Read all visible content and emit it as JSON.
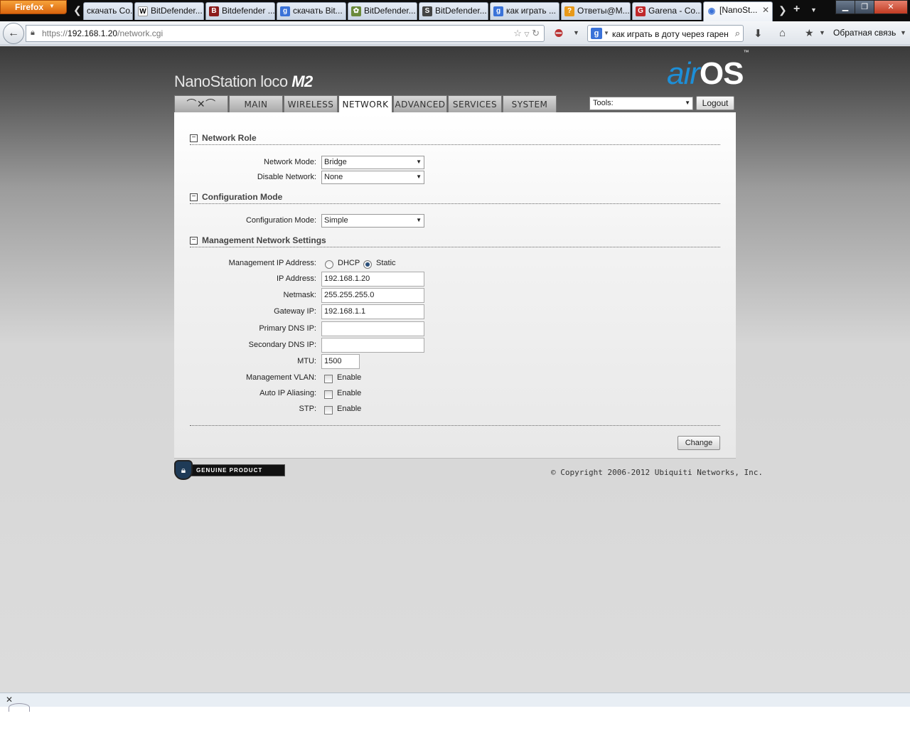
{
  "browser": {
    "menu_label": "Firefox",
    "tabs": [
      {
        "label": "скачать Co...",
        "icon": "google-icon"
      },
      {
        "label": "BitDefender...",
        "icon": "wikipedia-icon"
      },
      {
        "label": "Bitdefender ...",
        "icon": "bitdefender-icon"
      },
      {
        "label": "скачать Bit...",
        "icon": "google-icon"
      },
      {
        "label": "BitDefender...",
        "icon": "site-icon"
      },
      {
        "label": "BitDefender...",
        "icon": "site-s-icon"
      },
      {
        "label": "как играть ...",
        "icon": "google-icon"
      },
      {
        "label": "Ответы@M...",
        "icon": "answers-icon"
      },
      {
        "label": "Garena - Co...",
        "icon": "garena-icon"
      },
      {
        "label": "[NanoSt...",
        "icon": "rss-icon",
        "active": true
      }
    ],
    "url_prefix": "https://",
    "url_host": "192.168.1.20",
    "url_path": "/network.cgi",
    "search_query": "как играть в доту через гарену",
    "feedback_label": "Обратная связь"
  },
  "header": {
    "product_name": "NanoStation loco",
    "product_model": "M2",
    "os_prefix": "air",
    "os_name": "OS",
    "os_tm": "™"
  },
  "nav": {
    "tabs": [
      "MAIN",
      "WIRELESS",
      "NETWORK",
      "ADVANCED",
      "SERVICES",
      "SYSTEM"
    ],
    "active_tab": "NETWORK",
    "tools_label": "Tools:",
    "logout_label": "Logout"
  },
  "network_role": {
    "title": "Network Role",
    "network_mode_label": "Network Mode:",
    "network_mode_value": "Bridge",
    "disable_network_label": "Disable Network:",
    "disable_network_value": "None"
  },
  "configuration_mode": {
    "title": "Configuration Mode",
    "label": "Configuration Mode:",
    "value": "Simple"
  },
  "management": {
    "title": "Management Network Settings",
    "mgmt_ip_label": "Management IP Address:",
    "dhcp_label": "DHCP",
    "static_label": "Static",
    "selected": "Static",
    "ip_label": "IP Address:",
    "ip_value": "192.168.1.20",
    "netmask_label": "Netmask:",
    "netmask_value": "255.255.255.0",
    "gateway_label": "Gateway IP:",
    "gateway_value": "192.168.1.1",
    "primary_dns_label": "Primary DNS IP:",
    "primary_dns_value": "",
    "secondary_dns_label": "Secondary DNS IP:",
    "secondary_dns_value": "",
    "mtu_label": "MTU:",
    "mtu_value": "1500",
    "vlan_label": "Management VLAN:",
    "alias_label": "Auto IP Aliasing:",
    "stp_label": "STP:",
    "enable_label": "Enable"
  },
  "actions": {
    "change_label": "Change"
  },
  "footer": {
    "genuine_label": "GENUINE PRODUCT",
    "copyright": "© Copyright 2006-2012 Ubiquiti Networks, Inc."
  }
}
